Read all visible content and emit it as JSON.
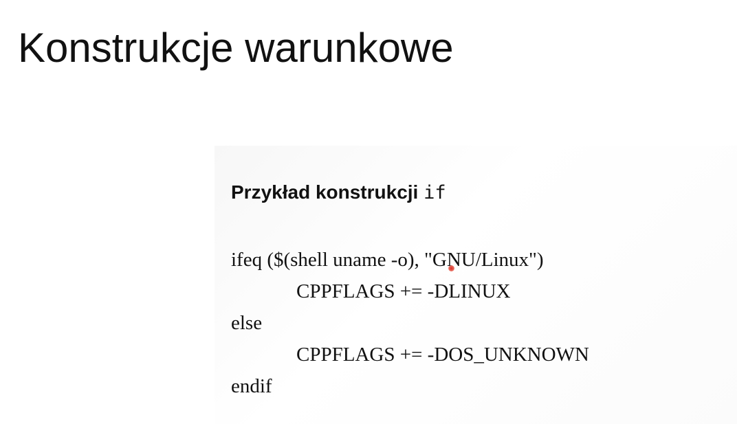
{
  "slide": {
    "title": "Konstrukcje warunkowe"
  },
  "example": {
    "heading_bold": "Przykład konstrukcji",
    "heading_code": "if",
    "code_lines": [
      "ifeq ($(shell uname -o), \"GNU/Linux\")",
      "CPPFLAGS += -DLINUX",
      "else",
      "CPPFLAGS += -DOS_UNKNOWN",
      "endif"
    ]
  },
  "colors": {
    "text": "#111111",
    "background": "#ffffff",
    "pointer": "#d9302b"
  }
}
